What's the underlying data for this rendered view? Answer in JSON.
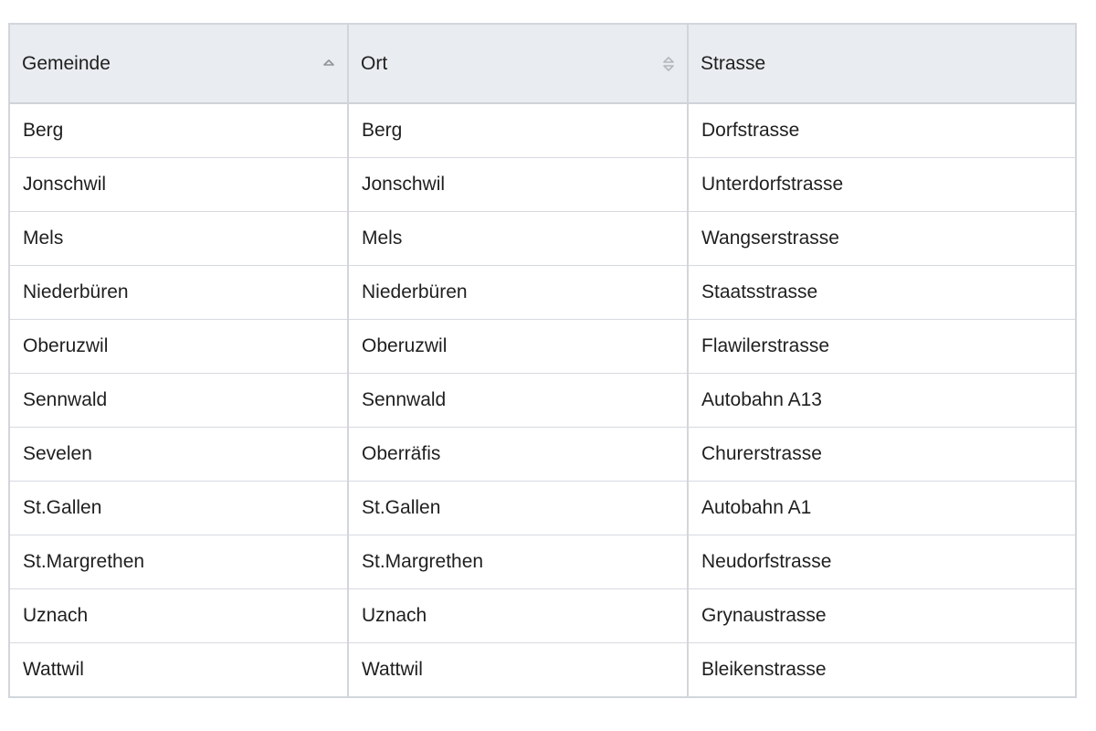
{
  "table": {
    "columns": [
      {
        "label": "Gemeinde",
        "sort": "ascending",
        "sort_icon": "sort-ascending-icon"
      },
      {
        "label": "Ort",
        "sort": "unsorted",
        "sort_icon": "sort-both-icon"
      },
      {
        "label": "Strasse",
        "sort": "none"
      }
    ],
    "rows": [
      {
        "gemeinde": "Berg",
        "ort": "Berg",
        "strasse": "Dorfstrasse"
      },
      {
        "gemeinde": "Jonschwil",
        "ort": "Jonschwil",
        "strasse": "Unterdorfstrasse"
      },
      {
        "gemeinde": "Mels",
        "ort": "Mels",
        "strasse": "Wangserstrasse"
      },
      {
        "gemeinde": "Niederbüren",
        "ort": "Niederbüren",
        "strasse": "Staatsstrasse"
      },
      {
        "gemeinde": "Oberuzwil",
        "ort": "Oberuzwil",
        "strasse": "Flawilerstrasse"
      },
      {
        "gemeinde": "Sennwald",
        "ort": "Sennwald",
        "strasse": "Autobahn A13"
      },
      {
        "gemeinde": "Sevelen",
        "ort": "Oberräfis",
        "strasse": "Churerstrasse"
      },
      {
        "gemeinde": "St.Gallen",
        "ort": "St.Gallen",
        "strasse": "Autobahn A1"
      },
      {
        "gemeinde": "St.Margrethen",
        "ort": "St.Margrethen",
        "strasse": "Neudorfstrasse"
      },
      {
        "gemeinde": "Uznach",
        "ort": "Uznach",
        "strasse": "Grynaustrasse"
      },
      {
        "gemeinde": "Wattwil",
        "ort": "Wattwil",
        "strasse": "Bleikenstrasse"
      }
    ]
  },
  "colors": {
    "header_bg": "#e9ecf0",
    "border": "#d2d6dc",
    "icon": "#8e949b"
  }
}
